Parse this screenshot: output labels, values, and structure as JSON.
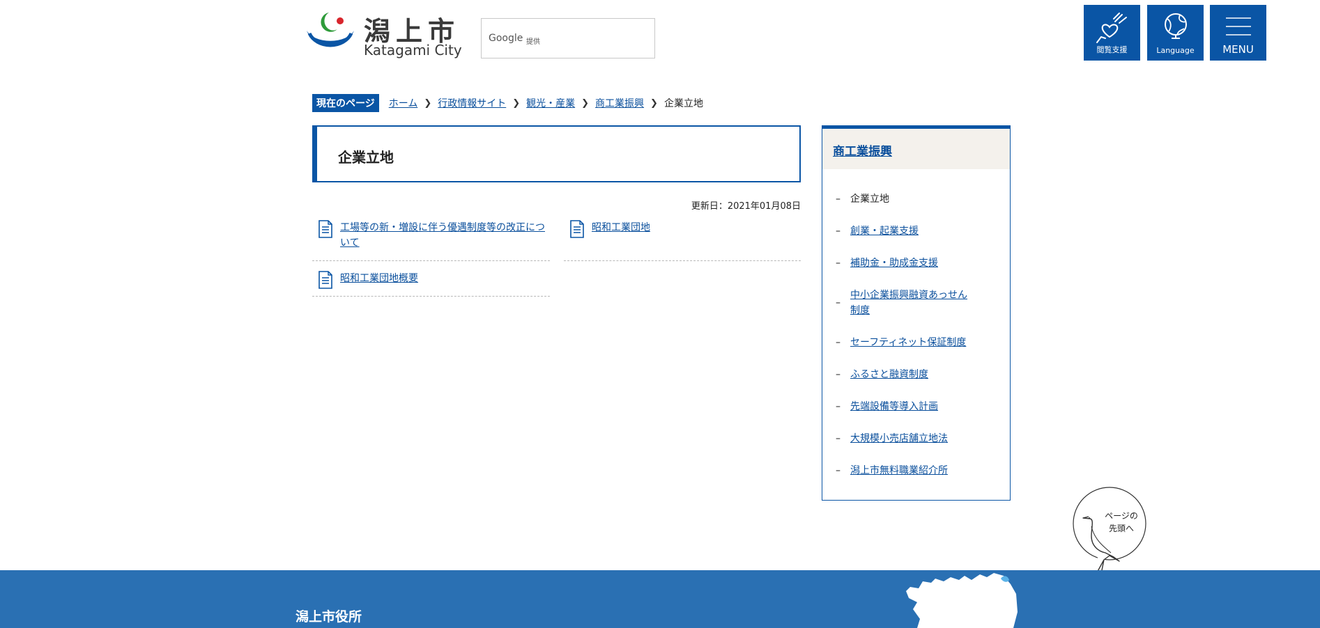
{
  "header": {
    "logo_jp": "潟上市",
    "logo_en": "Katagami City",
    "search_brand": "Google",
    "search_provided": "提供",
    "buttons": {
      "accessibility_label": "閲覧支援",
      "language_label": "Language",
      "menu_label": "MENU"
    }
  },
  "breadcrumb": {
    "here_label": "現在のページ",
    "items": [
      "ホーム",
      "行政情報サイト",
      "観光・産業",
      "商工業振興"
    ],
    "current": "企業立地"
  },
  "page": {
    "title": "企業立地",
    "updated": "更新日：2021年01月08日",
    "links": [
      "工場等の新・増設に伴う優遇制度等の改正について",
      "昭和工業団地",
      "昭和工業団地概要"
    ]
  },
  "sidebar": {
    "heading": "商工業振興",
    "items": [
      {
        "label": "企業立地",
        "current": true
      },
      {
        "label": "創業・起業支援"
      },
      {
        "label": "補助金・助成金支援"
      },
      {
        "label": "中小企業振興融資あっせん制度"
      },
      {
        "label": "セーフティネット保証制度"
      },
      {
        "label": "ふるさと融資制度"
      },
      {
        "label": "先端設備等導入計画"
      },
      {
        "label": "大規模小売店舗立地法"
      },
      {
        "label": "潟上市無料職業紹介所"
      }
    ]
  },
  "to_top": {
    "line1": "ページの",
    "line2": "先頭へ"
  },
  "footer": {
    "office_name": "潟上市役所"
  },
  "colors": {
    "primary": "#0a55a5",
    "footer": "#2a70b3",
    "link": "#0a4f9c",
    "sidebar_head_bg": "#f4f1ec"
  }
}
